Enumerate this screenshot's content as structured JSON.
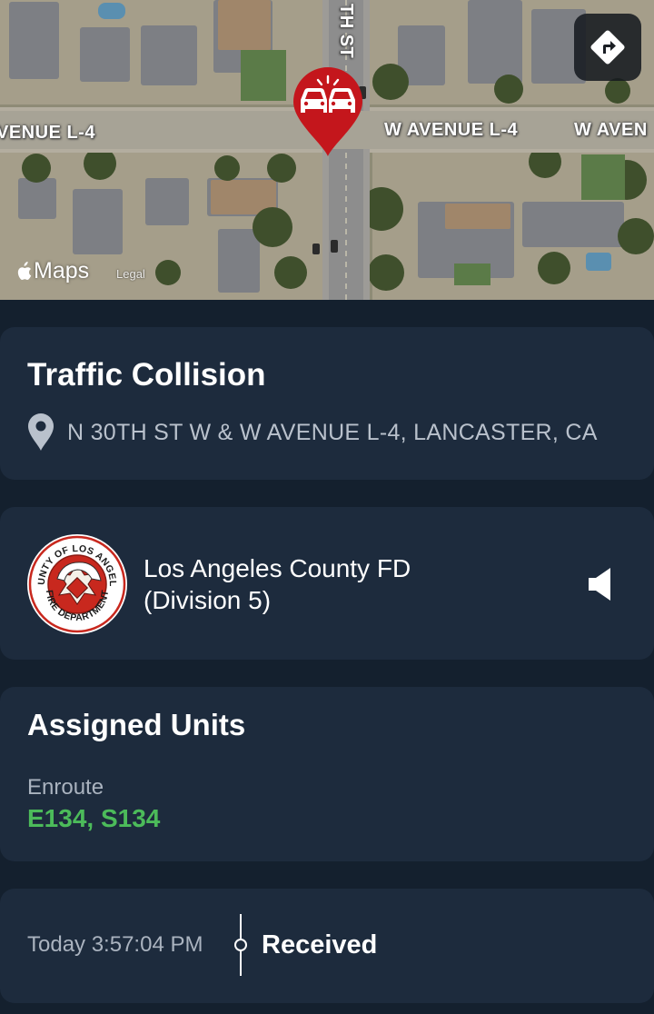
{
  "map": {
    "streets": {
      "avenue_west": "VENUE L-4",
      "avenue_east": "W AVENUE L-4",
      "avenue_far_east": "W AVEN",
      "cross_street": "TH ST"
    },
    "maps_brand": "Maps",
    "legal": "Legal",
    "directions_icon": "directions-arrow-icon",
    "pin_icon": "traffic-collision-icon",
    "pin_color": "#c4161c"
  },
  "incident": {
    "title": "Traffic Collision",
    "address": "N 30TH ST W & W AVENUE L-4, LANCASTER, CA"
  },
  "agency": {
    "name_line1": "Los Angeles County FD",
    "name_line2": "(Division 5)",
    "logo_text_top": "COUNTY OF LOS ANGELES",
    "logo_text_bottom": "FIRE DEPARTMENT"
  },
  "units": {
    "title": "Assigned Units",
    "status": "Enroute",
    "list": "E134, S134",
    "status_color": "#4cbb5a"
  },
  "timeline": {
    "time": "Today 3:57:04 PM",
    "event": "Received"
  },
  "colors": {
    "background": "#14202e",
    "card": "#1d2b3d"
  }
}
